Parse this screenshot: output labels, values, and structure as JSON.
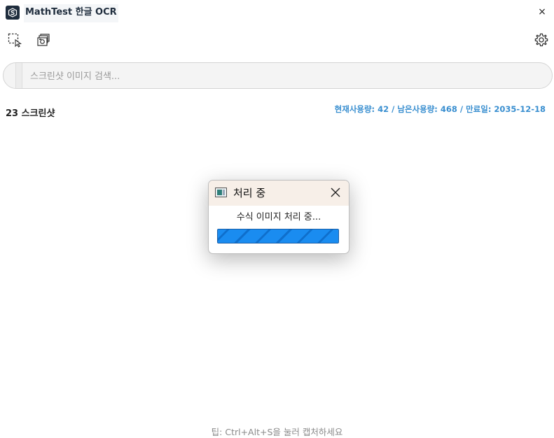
{
  "window": {
    "title": "MathTest 한글 OCR",
    "close_label": "×"
  },
  "toolbar": {
    "capture_icon": "screen-capture-icon",
    "batch_icon": "image-batch-icon",
    "settings_icon": "gear-icon"
  },
  "search": {
    "placeholder": "스크린샷 이미지 검색...",
    "value": ""
  },
  "gallery": {
    "count_label": "23 스크린샷"
  },
  "usage": {
    "text": "현재사용량: 42 / 남은사용량: 468 / 만료일: 2035-12-18"
  },
  "dialog": {
    "title": "처리 중",
    "message": "수식 이미지 처리 중...",
    "progress": 1.0
  },
  "footer": {
    "tip": "팁: Ctrl+Alt+S을 눌러 캡처하세요"
  },
  "colors": {
    "accent": "#3a8fd0",
    "progress": "#1684e6",
    "logo_bg": "#1f2d3d"
  }
}
